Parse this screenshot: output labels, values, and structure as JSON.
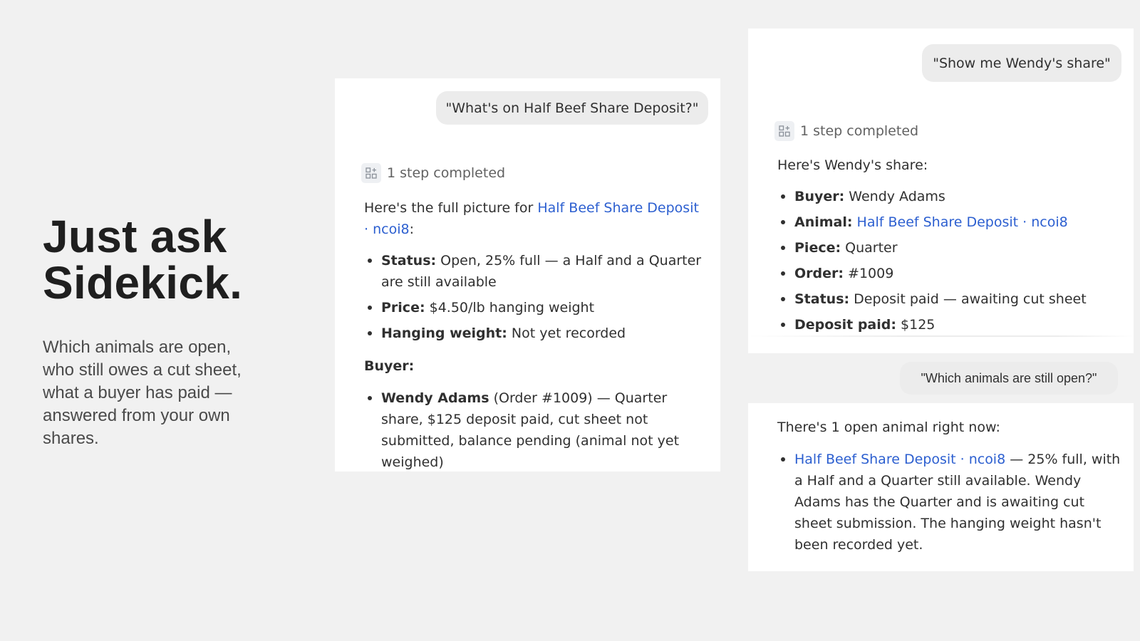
{
  "hero": {
    "title_line1": "Just ask",
    "title_line2": "Sidekick.",
    "subtitle": "Which animals are open, who still owes a cut sheet, what a buyer has paid — answered from your own shares."
  },
  "chat1": {
    "user_prompt": "\"What's on Half Beef Share Deposit?\"",
    "steps": "1 step completed",
    "intro_prefix": "Here's the full picture for",
    "intro_link": "Half Beef Share Deposit · ncoi8",
    "intro_suffix": ":",
    "details": [
      {
        "key": "Status:",
        "value": "Open, 25% full — a Half and a Quarter are still available"
      },
      {
        "key": "Price:",
        "value": "$4.50/lb hanging weight"
      },
      {
        "key": "Hanging weight:",
        "value": "Not yet recorded"
      }
    ],
    "buyer_heading": "Buyer:",
    "buyers": [
      {
        "key": "Wendy Adams",
        "value": "(Order #1009) — Quarter share, $125 deposit paid, cut sheet not submitted, balance pending (animal not yet weighed)"
      }
    ]
  },
  "chat2": {
    "user_prompt": "\"Show me Wendy's share\"",
    "steps": "1 step completed",
    "intro": "Here's Wendy's share:",
    "details": [
      {
        "key": "Buyer:",
        "value": "Wendy Adams"
      },
      {
        "key": "Animal:",
        "value": "Half Beef Share Deposit · ncoi8"
      },
      {
        "key": "Piece:",
        "value": "Quarter"
      },
      {
        "key": "Order:",
        "value": "#1009"
      },
      {
        "key": "Status:",
        "value": "Deposit paid — awaiting cut sheet"
      },
      {
        "key": "Deposit paid:",
        "value": "$125"
      }
    ]
  },
  "chat3": {
    "user_prompt": "\"Which animals are still open?\"",
    "intro": "There's 1 open animal right now:",
    "item_link": "Half Beef Share Deposit · ncoi8",
    "item_text": "— 25% full, with a Half and a Quarter still available. Wendy Adams has the Quarter and is awaiting cut sheet submission. The hanging weight hasn't been recorded yet."
  },
  "colors": {
    "background": "#f1f1f1",
    "panel": "#ffffff",
    "bubble": "#ececec",
    "link": "#2c5fd0"
  },
  "icons": {
    "steps": "steps-grid-icon"
  }
}
